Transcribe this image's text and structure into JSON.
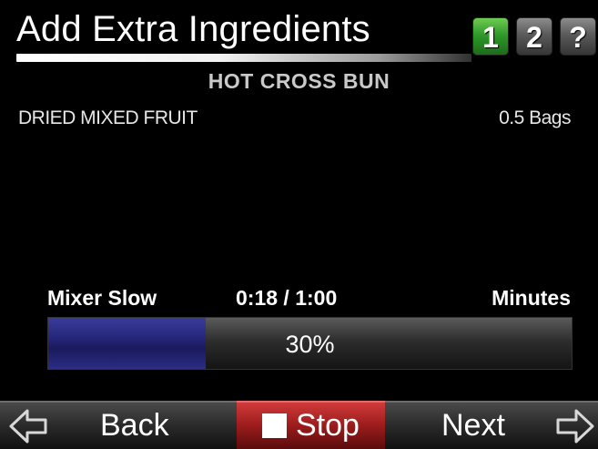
{
  "header": {
    "title": "Add Extra Ingredients",
    "tabs": [
      {
        "label": "1",
        "active": true
      },
      {
        "label": "2",
        "active": false
      },
      {
        "label": "?",
        "active": false
      }
    ]
  },
  "recipe": {
    "name": "HOT CROSS BUN"
  },
  "ingredient": {
    "name": "DRIED MIXED FRUIT",
    "quantity": "0.5 Bags"
  },
  "mixer": {
    "label": "Mixer Slow",
    "time": "0:18  / 1:00",
    "unit": "Minutes",
    "progress_text": "30%",
    "progress_fraction": 0.3
  },
  "footer": {
    "back_label": "Back",
    "stop_label": "Stop",
    "next_label": "Next",
    "back_icon": "arrow-left-icon",
    "next_icon": "arrow-right-icon",
    "stop_icon": "stop-square-icon"
  },
  "colors": {
    "active_tab": "#2f9a2a",
    "progress_fill": "#25267a",
    "stop_button": "#9b1c1c"
  }
}
